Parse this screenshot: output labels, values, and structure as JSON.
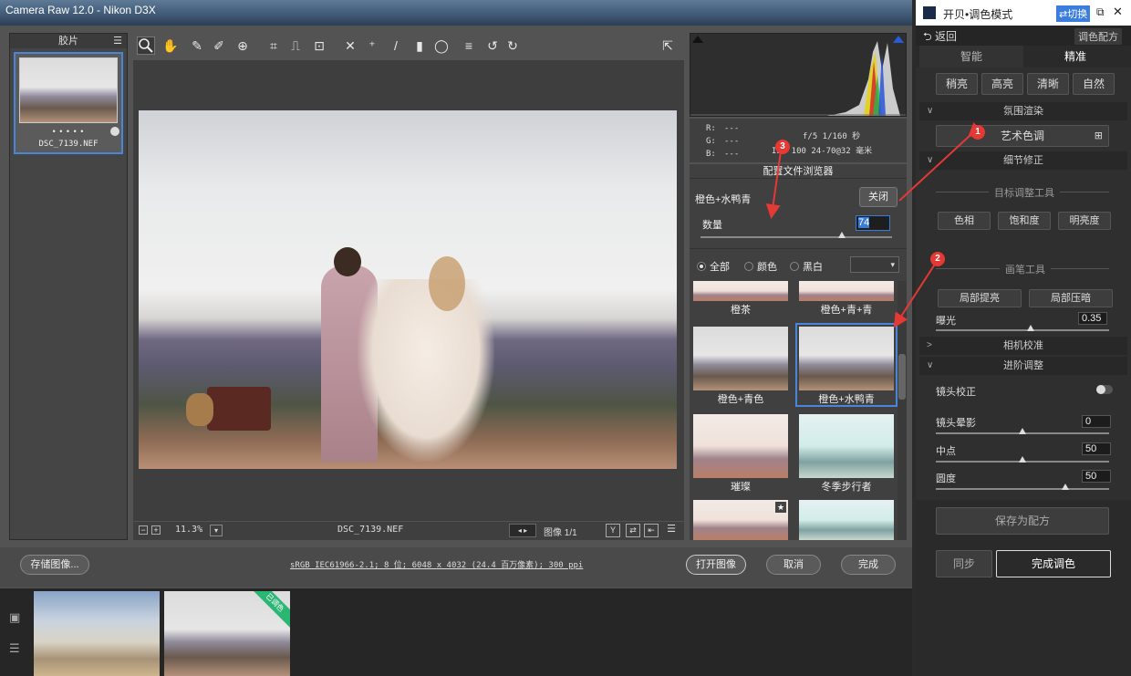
{
  "window": {
    "title": "Camera Raw 12.0 -  Nikon D3X"
  },
  "filmstrip": {
    "header": "胶片",
    "menu_icon": "☰",
    "file_name": "DSC_7139.NEF",
    "dots": "• • • • •"
  },
  "preview": {
    "zoom": "11.3%",
    "file_name": "DSC_7139.NEF",
    "image_counter": "图像 1/1"
  },
  "histogram": {
    "r_label": "R:",
    "g_label": "G:",
    "b_label": "B:",
    "rgb_values": [
      "---",
      "---",
      "---"
    ],
    "exif_line1": "f/5   1/160 秒",
    "exif_line2": "ISO 100  24-70@32 毫米"
  },
  "profile_browser": {
    "title": "配置文件浏览器",
    "current_profile": "橙色+水鸭青",
    "close_label": "关闭",
    "amount_label": "数量",
    "amount_value": "74",
    "amount_fraction": 0.74,
    "filters": [
      {
        "label": "全部",
        "selected": true
      },
      {
        "label": "颜色",
        "selected": false
      },
      {
        "label": "黑白",
        "selected": false
      }
    ],
    "profiles": [
      "橙茶",
      "橙色+青+青",
      "橙色+青色",
      "橙色+水鸭青",
      "璀璨",
      "冬季步行者"
    ]
  },
  "footer": {
    "save_label": "存储图像...",
    "info_link": "sRGB IEC61966-2.1; 8 位; 6048 x 4032 (24.4 百万像素); 300 ppi",
    "open_label": "打开图像",
    "cancel_label": "取消",
    "done_label": "完成"
  },
  "bottom_strip": {
    "badge": "已调色"
  },
  "plugin": {
    "title": "开贝•调色模式",
    "switch_label": "⇄切换",
    "back_label": "返回",
    "preset_label": "调色配方",
    "tabs": [
      {
        "label": "智能",
        "active": false
      },
      {
        "label": "精准",
        "active": true
      }
    ],
    "presets": [
      "稍亮",
      "高亮",
      "清晰",
      "自然"
    ],
    "section_atmosphere": "氛围渲染",
    "art_tone_label": "艺术色调",
    "section_detail": "细节修正",
    "target_tool": "目标调整工具",
    "target_buttons": [
      "色相",
      "饱和度",
      "明亮度"
    ],
    "brush_tool": "画笔工具",
    "brush_buttons": [
      "局部提亮",
      "局部压暗"
    ],
    "exposure_label": "曝光",
    "exposure_value": "0.35",
    "section_camera": "相机校准",
    "section_advanced": "进阶调整",
    "lens_correction": "镜头校正",
    "vignette_label": "镜头晕影",
    "vignette_value": "0",
    "midpoint_label": "中点",
    "midpoint_value": "50",
    "roundness_label": "圆度",
    "roundness_value": "50",
    "save_preset_label": "保存为配方",
    "sync_label": "同步",
    "finish_label": "完成调色"
  },
  "annotations": [
    "1",
    "2",
    "3"
  ],
  "colors": {
    "accent_red": "#e53935",
    "selection_blue": "#4a86d8",
    "badge_green": "#2bb673"
  }
}
